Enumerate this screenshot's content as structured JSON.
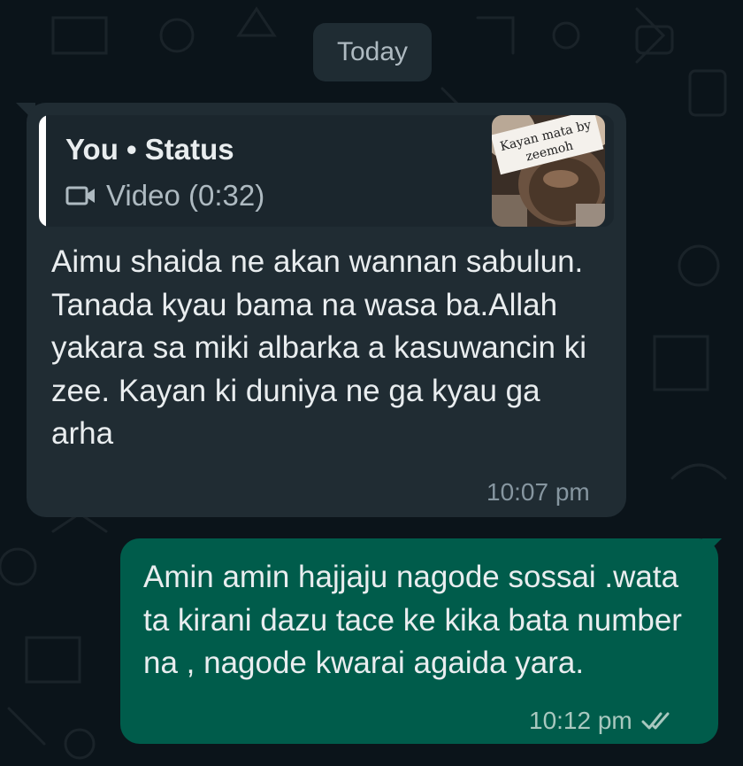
{
  "date_divider": "Today",
  "incoming_message": {
    "quote": {
      "author": "You • Status",
      "media_label": "Video (0:32)",
      "media_icon": "video-camera-icon",
      "thumbnail_caption": "Kayan mata by zeemoh"
    },
    "text": "Aimu shaida ne akan wannan sabulun. Tanada kyau bama na wasa ba.Allah yakara sa miki albarka a kasuwancin ki zee. Kayan ki duniya ne ga kyau ga arha",
    "time": "10:07 pm"
  },
  "outgoing_message": {
    "text": "Amin amin hajjaju nagode sossai .wata ta kirani dazu tace ke kika bata number na , nagode kwarai agaida yara.",
    "time": "10:12 pm",
    "status_icon": "double-check-icon"
  },
  "colors": {
    "background": "#0b141a",
    "incoming_bubble": "#202c33",
    "outgoing_bubble": "#005c4b",
    "text": "#e9edef",
    "meta_text": "#8696a0"
  }
}
